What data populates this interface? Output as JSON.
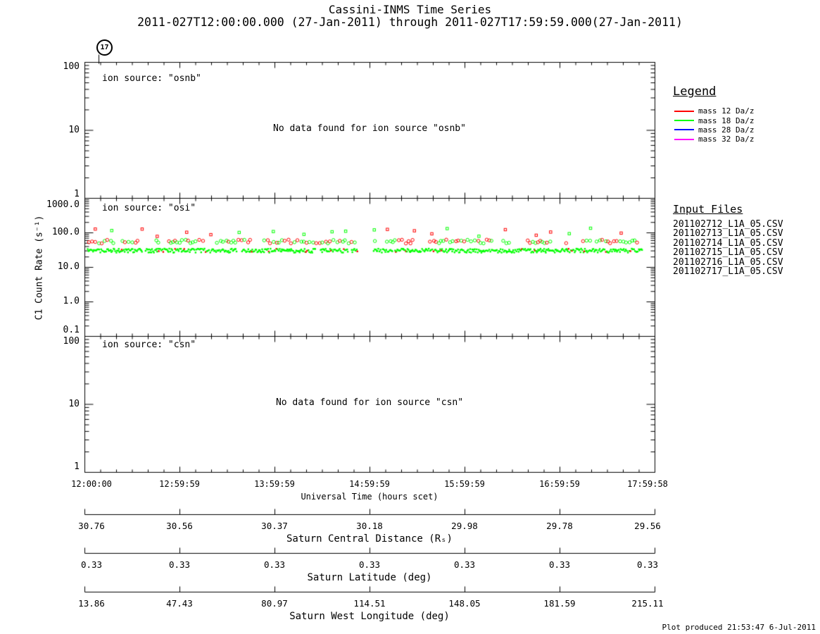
{
  "title": "Cassini-INMS Time Series",
  "subtitle": "2011-027T12:00:00.000 (27-Jan-2011) through 2011-027T17:59:59.000(27-Jan-2011)",
  "orbit_marker": "17",
  "y_axis_label": "C1 Count Rate (s⁻¹)",
  "panels": [
    {
      "id": "osnb",
      "label": "ion source: \"osnb\"",
      "no_data": "No data found for ion source \"osnb\"",
      "yticks": [
        "100",
        "10",
        "1"
      ]
    },
    {
      "id": "osi",
      "label": "ion source: \"osi\"",
      "yticks": [
        "1000.0",
        "100.0",
        "10.0",
        "1.0",
        "0.1"
      ]
    },
    {
      "id": "csn",
      "label": "ion source: \"csn\"",
      "no_data": "No data found for ion source \"csn\"",
      "yticks": [
        "100",
        "10",
        "1"
      ]
    }
  ],
  "x_axis": {
    "label": "Universal Time (hours scet)",
    "ticks": [
      "12:00:00",
      "12:59:59",
      "13:59:59",
      "14:59:59",
      "15:59:59",
      "16:59:59",
      "17:59:58"
    ]
  },
  "legend": {
    "title": "Legend",
    "items": [
      {
        "label": "mass 12 Da/z",
        "color": "#ff0000"
      },
      {
        "label": "mass 18 Da/z",
        "color": "#00ff00"
      },
      {
        "label": "mass 28 Da/z",
        "color": "#0000ff"
      },
      {
        "label": "mass 32 Da/z",
        "color": "#ff00ff"
      }
    ]
  },
  "input_files": {
    "title": "Input Files",
    "files": [
      "201102712_L1A_05.CSV",
      "201102713_L1A_05.CSV",
      "201102714_L1A_05.CSV",
      "201102715_L1A_05.CSV",
      "201102716_L1A_05.CSV",
      "201102717_L1A_05.CSV"
    ]
  },
  "bottom_axes": [
    {
      "label": "Saturn Central Distance (Rₛ)",
      "values": [
        "30.76",
        "30.56",
        "30.37",
        "30.18",
        "29.98",
        "29.78",
        "29.56"
      ]
    },
    {
      "label": "Saturn Latitude (deg)",
      "values": [
        "0.33",
        "0.33",
        "0.33",
        "0.33",
        "0.33",
        "0.33",
        "0.33"
      ]
    },
    {
      "label": "Saturn West Longitude (deg)",
      "values": [
        "13.86",
        "47.43",
        "80.97",
        "114.51",
        "148.05",
        "181.59",
        "215.11"
      ]
    }
  ],
  "footer": "Plot produced 21:53:47  6-Jul-2011",
  "chart_data": {
    "type": "scatter",
    "title": "Cassini-INMS Time Series",
    "xlabel": "Universal Time (hours scet)",
    "ylabel": "C1 Count Rate (s⁻¹)",
    "x_ticks_scet": [
      "12:00:00",
      "12:59:59",
      "13:59:59",
      "14:59:59",
      "15:59:59",
      "16:59:59",
      "17:59:58"
    ],
    "panels": [
      {
        "ion_source": "osnb",
        "yscale": "log",
        "ylim": [
          1,
          100
        ],
        "series": [],
        "annotation": "No data found for ion source \"osnb\""
      },
      {
        "ion_source": "osi",
        "yscale": "log",
        "ylim": [
          0.1,
          1000
        ],
        "series": [
          {
            "name": "mass 12 Da/z",
            "color": "#ff0000",
            "visible": true
          },
          {
            "name": "mass 18 Da/z",
            "color": "#00ff00",
            "visible": true
          },
          {
            "name": "mass 28 Da/z",
            "color": "#0000ff",
            "visible": false
          },
          {
            "name": "mass 32 Da/z",
            "color": "#ff00ff",
            "visible": false
          }
        ],
        "bands": [
          {
            "marker": "open-square",
            "colors": [
              "#ff0000",
              "#00ff00"
            ],
            "red_fraction": 0.55,
            "value_range": [
              75,
              140
            ],
            "density": "sparse"
          },
          {
            "marker": "open-circle",
            "colors": [
              "#ff0000",
              "#00ff00"
            ],
            "red_fraction": 0.45,
            "value_range": [
              48,
              62
            ],
            "density": "dense"
          },
          {
            "marker": "filled-dot",
            "colors": [
              "#00ff00",
              "#ff0000"
            ],
            "red_fraction": 0.05,
            "value_range": [
              26,
              34
            ],
            "density": "continuous-band"
          }
        ],
        "time_coverage": [
          "12:01:30",
          "17:52:00"
        ],
        "data_gap": [
          "14:52:00",
          "15:01:30"
        ]
      },
      {
        "ion_source": "csn",
        "yscale": "log",
        "ylim": [
          1,
          100
        ],
        "series": [],
        "annotation": "No data found for ion source \"csn\""
      }
    ]
  }
}
